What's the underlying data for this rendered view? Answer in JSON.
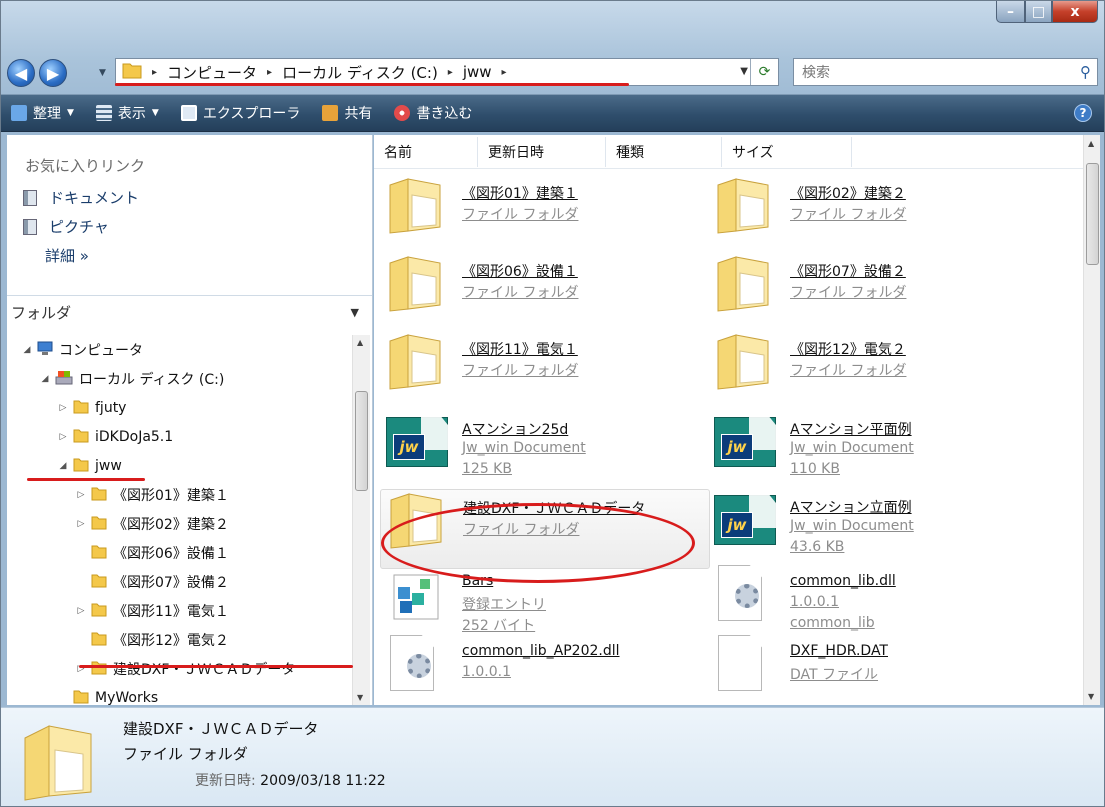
{
  "window": {
    "min_glyph": "–",
    "max_glyph": "□",
    "close_glyph": "x"
  },
  "nav": {
    "back": "◀",
    "forward": "▶",
    "drop": "▼",
    "crumbs": [
      "コンピュータ",
      "ローカル ディスク (C:)",
      "jww"
    ],
    "sep": "▸",
    "search_placeholder": "検索"
  },
  "toolbar": {
    "organize": "整理",
    "views": "表示",
    "explorer": "エクスプローラ",
    "share": "共有",
    "burn": "書き込む",
    "help": "?"
  },
  "sidebar": {
    "favorites_header": "お気に入りリンク",
    "favorites": [
      "ドキュメント",
      "ピクチャ"
    ],
    "more": "詳細 »",
    "folders_header": "フォルダ",
    "tree": [
      {
        "label": "コンピュータ",
        "indent": 0,
        "tw": "◢",
        "icon": "pc"
      },
      {
        "label": "ローカル ディスク (C:)",
        "indent": 1,
        "tw": "◢",
        "icon": "disk"
      },
      {
        "label": "fjuty",
        "indent": 2,
        "tw": "▷",
        "icon": "folder"
      },
      {
        "label": "iDKDoJa5.1",
        "indent": 2,
        "tw": "▷",
        "icon": "folder"
      },
      {
        "label": "jww",
        "indent": 2,
        "tw": "◢",
        "icon": "folder"
      },
      {
        "label": "《図形01》建築１",
        "indent": 3,
        "tw": "▷",
        "icon": "folder"
      },
      {
        "label": "《図形02》建築２",
        "indent": 3,
        "tw": "▷",
        "icon": "folder"
      },
      {
        "label": "《図形06》設備１",
        "indent": 3,
        "tw": "",
        "icon": "folder"
      },
      {
        "label": "《図形07》設備２",
        "indent": 3,
        "tw": "",
        "icon": "folder"
      },
      {
        "label": "《図形11》電気１",
        "indent": 3,
        "tw": "▷",
        "icon": "folder"
      },
      {
        "label": "《図形12》電気２",
        "indent": 3,
        "tw": "",
        "icon": "folder"
      },
      {
        "label": "建設DXF・ＪＷＣＡＤデータ",
        "indent": 3,
        "tw": "▷",
        "icon": "folder"
      },
      {
        "label": "MyWorks",
        "indent": 2,
        "tw": "",
        "icon": "folder"
      }
    ]
  },
  "columns": [
    "名前",
    "更新日時",
    "種類",
    "サイズ"
  ],
  "items": [
    {
      "name": "《図形01》建築１",
      "l2": "ファイル フォルダ",
      "l3": "",
      "icon": "folder"
    },
    {
      "name": "《図形02》建築２",
      "l2": "ファイル フォルダ",
      "l3": "",
      "icon": "folder"
    },
    {
      "name": "《図形06》設備１",
      "l2": "ファイル フォルダ",
      "l3": "",
      "icon": "folder"
    },
    {
      "name": "《図形07》設備２",
      "l2": "ファイル フォルダ",
      "l3": "",
      "icon": "folder"
    },
    {
      "name": "《図形11》電気１",
      "l2": "ファイル フォルダ",
      "l3": "",
      "icon": "folder"
    },
    {
      "name": "《図形12》電気２",
      "l2": "ファイル フォルダ",
      "l3": "",
      "icon": "folder"
    },
    {
      "name": "Aマンション25d",
      "l2": "Jw_win Document",
      "l3": "125 KB",
      "icon": "jw"
    },
    {
      "name": "Aマンション平面例",
      "l2": "Jw_win Document",
      "l3": "110 KB",
      "icon": "jw"
    },
    {
      "name": "建設DXF・ＪＷＣＡＤデータ",
      "l2": "ファイル フォルダ",
      "l3": "",
      "icon": "folder"
    },
    {
      "name": "Aマンション立面例",
      "l2": "Jw_win Document",
      "l3": "43.6 KB",
      "icon": "jw"
    },
    {
      "name": "Bars",
      "l2": "登録エントリ",
      "l3": "252 バイト",
      "icon": "reg"
    },
    {
      "name": "common_lib.dll",
      "l2": "1.0.0.1",
      "l3": "common_lib",
      "icon": "dll"
    },
    {
      "name": "common_lib_AP202.dll",
      "l2": "1.0.0.1",
      "l3": "",
      "icon": "dll"
    },
    {
      "name": "DXF_HDR.DAT",
      "l2": "DAT ファイル",
      "l3": "",
      "icon": "dat"
    }
  ],
  "details": {
    "name": "建設DXF・ＪＷＣＡＤデータ",
    "type": "ファイル フォルダ",
    "date_label": "更新日時:",
    "date_value": "2009/03/18 11:22"
  },
  "jw_label": "jw",
  "accent": {
    "highlight": "#d81c1c",
    "folder": "#f4c84a",
    "toolbar": "#2f4e6c"
  }
}
